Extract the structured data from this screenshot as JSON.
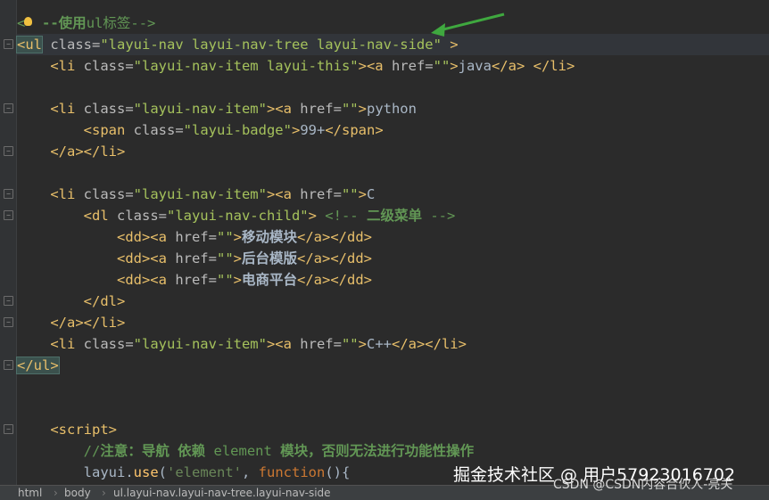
{
  "editor": {
    "lines": [
      {
        "id": "l1",
        "segments": [
          {
            "c": "com",
            "t": "<"
          },
          {
            "c": "com",
            "t": "  "
          },
          {
            "c": "com bold",
            "t": "--使用"
          },
          {
            "c": "com",
            "t": "ul"
          },
          {
            "c": "com",
            "t": "标签-->"
          }
        ]
      },
      {
        "id": "l2",
        "segments": [
          {
            "c": "tag ul-box",
            "t": "<ul"
          },
          {
            "c": "attr",
            "t": " class="
          },
          {
            "c": "val",
            "t": "\"layui-nav layui-nav-tree layui-nav-side\""
          },
          {
            "c": "tag",
            "t": " >"
          }
        ]
      },
      {
        "id": "l3",
        "segments": [
          {
            "c": "text",
            "t": "    "
          },
          {
            "c": "tag",
            "t": "<li"
          },
          {
            "c": "attr",
            "t": " class="
          },
          {
            "c": "val",
            "t": "\"layui-nav-item layui-this\""
          },
          {
            "c": "tag",
            "t": "><a"
          },
          {
            "c": "attr",
            "t": " href="
          },
          {
            "c": "val",
            "t": "\"\""
          },
          {
            "c": "tag",
            "t": ">"
          },
          {
            "c": "text",
            "t": "java"
          },
          {
            "c": "tag",
            "t": "</a>"
          },
          {
            "c": "text",
            "t": " "
          },
          {
            "c": "tag",
            "t": "</li>"
          }
        ]
      },
      {
        "id": "l4",
        "segments": []
      },
      {
        "id": "l5",
        "segments": [
          {
            "c": "text",
            "t": "    "
          },
          {
            "c": "tag",
            "t": "<li"
          },
          {
            "c": "attr",
            "t": " class="
          },
          {
            "c": "val",
            "t": "\"layui-nav-item\""
          },
          {
            "c": "tag",
            "t": "><a"
          },
          {
            "c": "attr",
            "t": " href="
          },
          {
            "c": "val",
            "t": "\"\""
          },
          {
            "c": "tag",
            "t": ">"
          },
          {
            "c": "text",
            "t": "python"
          }
        ]
      },
      {
        "id": "l6",
        "segments": [
          {
            "c": "text",
            "t": "        "
          },
          {
            "c": "tag",
            "t": "<span"
          },
          {
            "c": "attr",
            "t": " class="
          },
          {
            "c": "val",
            "t": "\"layui-badge\""
          },
          {
            "c": "tag",
            "t": ">"
          },
          {
            "c": "text",
            "t": "99+"
          },
          {
            "c": "tag",
            "t": "</span>"
          }
        ]
      },
      {
        "id": "l7",
        "segments": [
          {
            "c": "text",
            "t": "    "
          },
          {
            "c": "tag",
            "t": "</a></li>"
          }
        ]
      },
      {
        "id": "l8",
        "segments": []
      },
      {
        "id": "l9",
        "segments": [
          {
            "c": "text",
            "t": "    "
          },
          {
            "c": "tag",
            "t": "<li"
          },
          {
            "c": "attr",
            "t": " class="
          },
          {
            "c": "val",
            "t": "\"layui-nav-item\""
          },
          {
            "c": "tag",
            "t": "><a"
          },
          {
            "c": "attr",
            "t": " href="
          },
          {
            "c": "val",
            "t": "\"\""
          },
          {
            "c": "tag",
            "t": ">"
          },
          {
            "c": "text",
            "t": "C"
          }
        ]
      },
      {
        "id": "l10",
        "segments": [
          {
            "c": "text",
            "t": "        "
          },
          {
            "c": "tag",
            "t": "<dl"
          },
          {
            "c": "attr",
            "t": " class="
          },
          {
            "c": "val",
            "t": "\"layui-nav-child\""
          },
          {
            "c": "tag",
            "t": ">"
          },
          {
            "c": "com",
            "t": " <!-- "
          },
          {
            "c": "com bold",
            "t": "二级菜单"
          },
          {
            "c": "com",
            "t": " -->"
          }
        ]
      },
      {
        "id": "l11",
        "segments": [
          {
            "c": "text",
            "t": "            "
          },
          {
            "c": "tag",
            "t": "<dd><a"
          },
          {
            "c": "attr",
            "t": " href="
          },
          {
            "c": "val",
            "t": "\"\""
          },
          {
            "c": "tag",
            "t": ">"
          },
          {
            "c": "text bold",
            "t": "移动模块"
          },
          {
            "c": "tag",
            "t": "</a></dd>"
          }
        ]
      },
      {
        "id": "l12",
        "segments": [
          {
            "c": "text",
            "t": "            "
          },
          {
            "c": "tag",
            "t": "<dd><a"
          },
          {
            "c": "attr",
            "t": " href="
          },
          {
            "c": "val",
            "t": "\"\""
          },
          {
            "c": "tag",
            "t": ">"
          },
          {
            "c": "text bold",
            "t": "后台模版"
          },
          {
            "c": "tag",
            "t": "</a></dd>"
          }
        ]
      },
      {
        "id": "l13",
        "segments": [
          {
            "c": "text",
            "t": "            "
          },
          {
            "c": "tag",
            "t": "<dd><a"
          },
          {
            "c": "attr",
            "t": " href="
          },
          {
            "c": "val",
            "t": "\"\""
          },
          {
            "c": "tag",
            "t": ">"
          },
          {
            "c": "text bold",
            "t": "电商平台"
          },
          {
            "c": "tag",
            "t": "</a></dd>"
          }
        ]
      },
      {
        "id": "l14",
        "segments": [
          {
            "c": "text",
            "t": "        "
          },
          {
            "c": "tag",
            "t": "</dl>"
          }
        ]
      },
      {
        "id": "l15",
        "segments": [
          {
            "c": "text",
            "t": "    "
          },
          {
            "c": "tag",
            "t": "</a></li>"
          }
        ]
      },
      {
        "id": "l16",
        "segments": [
          {
            "c": "text",
            "t": "    "
          },
          {
            "c": "tag",
            "t": "<li"
          },
          {
            "c": "attr",
            "t": " class="
          },
          {
            "c": "val",
            "t": "\"layui-nav-item\""
          },
          {
            "c": "tag",
            "t": "><a"
          },
          {
            "c": "attr",
            "t": " href="
          },
          {
            "c": "val",
            "t": "\"\""
          },
          {
            "c": "tag",
            "t": ">"
          },
          {
            "c": "text",
            "t": "C++"
          },
          {
            "c": "tag",
            "t": "</a></li>"
          }
        ]
      },
      {
        "id": "l17",
        "segments": [
          {
            "c": "tag ul-box",
            "t": "</ul>"
          }
        ]
      },
      {
        "id": "l18",
        "segments": []
      },
      {
        "id": "l19",
        "segments": []
      },
      {
        "id": "l20",
        "segments": [
          {
            "c": "text",
            "t": "    "
          },
          {
            "c": "tag",
            "t": "<script>"
          }
        ]
      },
      {
        "id": "l21",
        "segments": [
          {
            "c": "text",
            "t": "        "
          },
          {
            "c": "com",
            "t": "//"
          },
          {
            "c": "com bold",
            "t": "注意：导航 依赖"
          },
          {
            "c": "com",
            "t": " element "
          },
          {
            "c": "com bold",
            "t": "模块，否则无法进行功能性操作"
          }
        ]
      },
      {
        "id": "l22",
        "segments": [
          {
            "c": "text",
            "t": "        "
          },
          {
            "c": "ident",
            "t": "layui."
          },
          {
            "c": "fn",
            "t": "use"
          },
          {
            "c": "ident",
            "t": "("
          },
          {
            "c": "str",
            "t": "'element'"
          },
          {
            "c": "ident",
            "t": ", "
          },
          {
            "c": "kw",
            "t": "function"
          },
          {
            "c": "ident",
            "t": "(){"
          }
        ]
      }
    ]
  },
  "statusbar": {
    "breadcrumbs": [
      "html",
      "body",
      "ul.layui-nav.layui-nav-tree.layui-nav-side"
    ]
  },
  "watermark": {
    "line1": "掘金技术社区 @ 用户57923016702",
    "line2": "CSDN @CSDN内容合伙人-亮关"
  }
}
